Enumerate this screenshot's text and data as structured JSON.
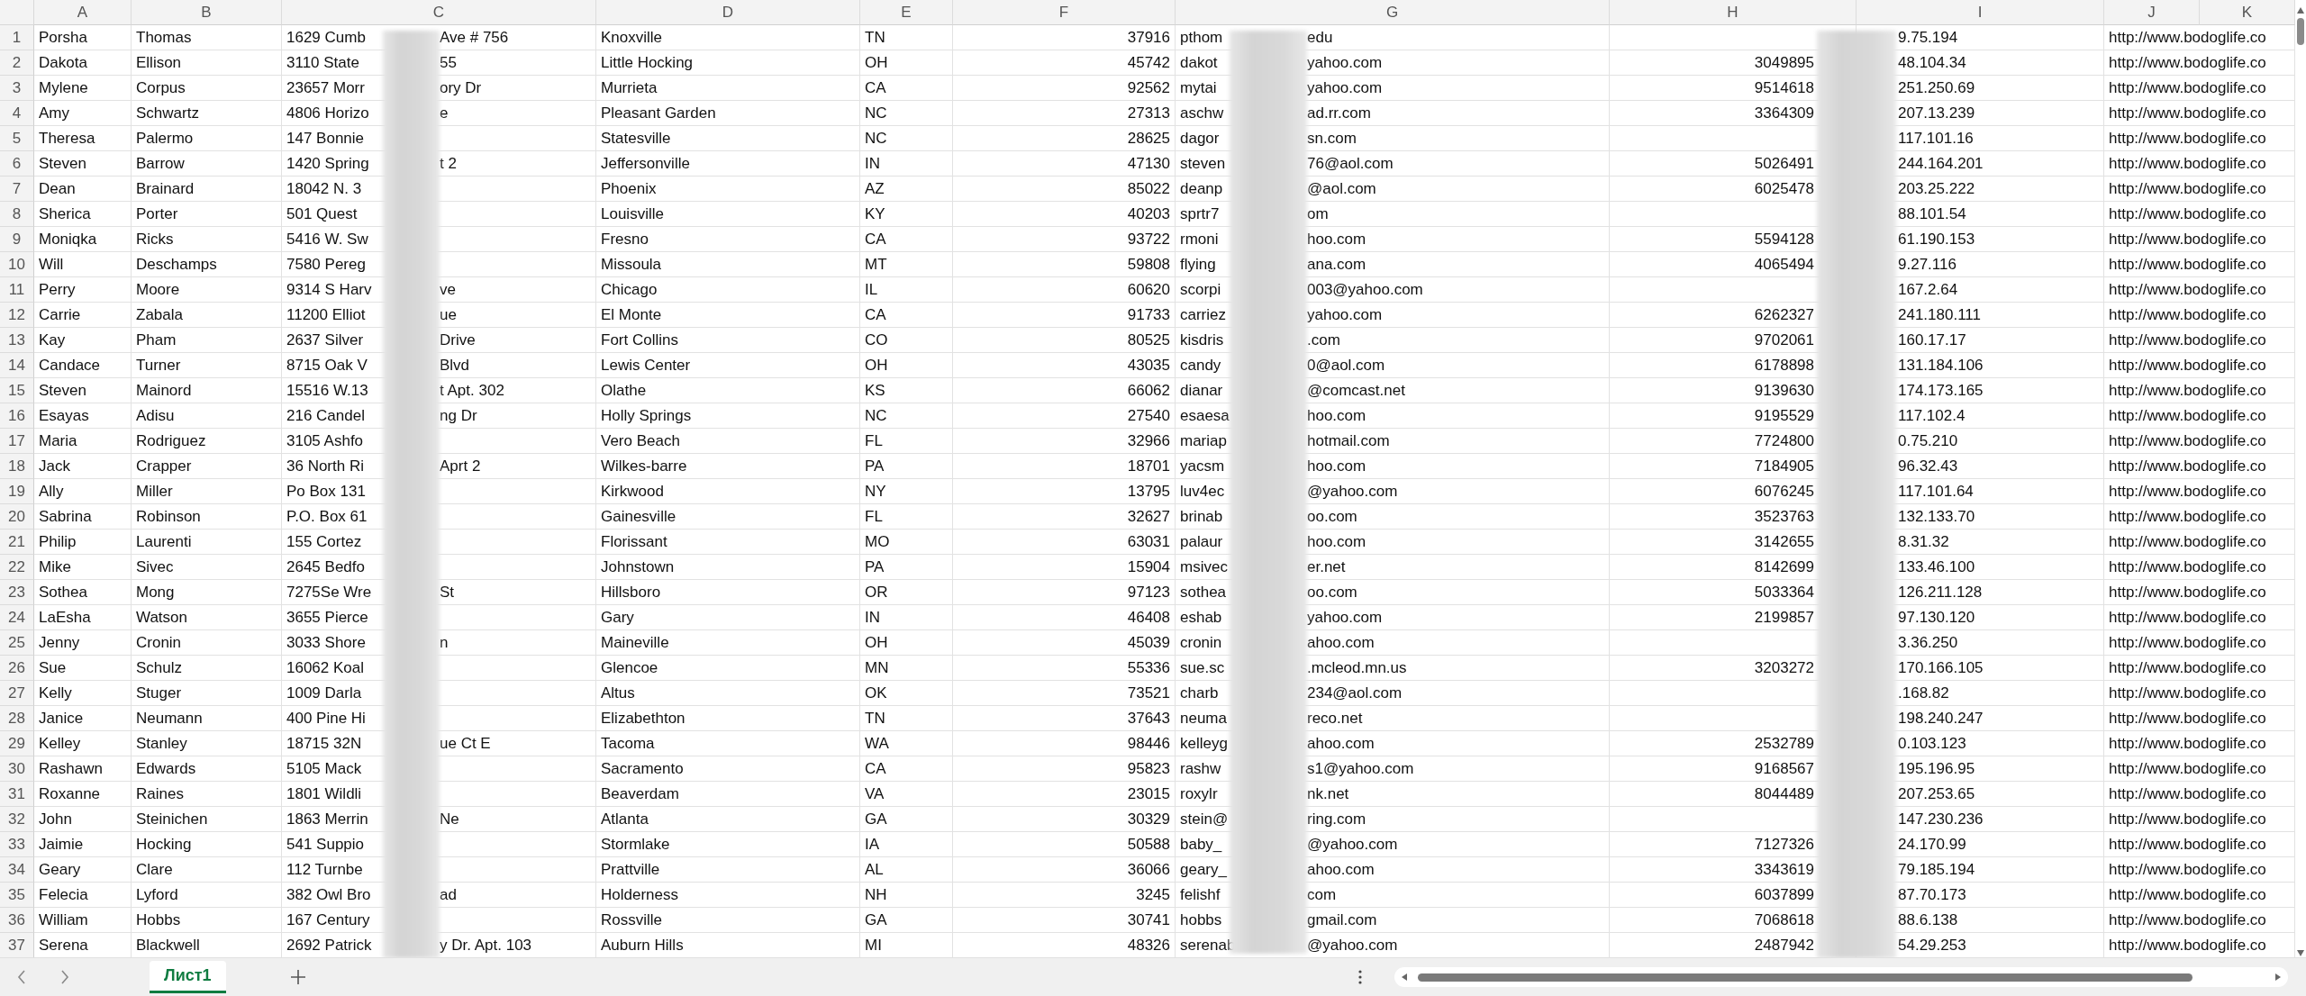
{
  "columns": [
    "A",
    "B",
    "C",
    "D",
    "E",
    "F",
    "G",
    "H",
    "I",
    "J",
    "K"
  ],
  "rows": [
    {
      "n": "1",
      "a": "Porsha",
      "b": "Thomas",
      "c": {
        "start": "1629 Cumb",
        "end": "Ave # 756"
      },
      "d": "Knoxville",
      "e": "TN",
      "f": "37916",
      "g": {
        "start": "pthom",
        "end": "edu"
      },
      "i": "9.75.194",
      "j": "http://www.bodoglife.co"
    },
    {
      "n": "2",
      "a": "Dakota",
      "b": "Ellison",
      "c": {
        "start": "3110 State",
        "end": "55"
      },
      "d": "Little Hocking",
      "e": "OH",
      "f": "45742",
      "g": {
        "start": "dakot",
        "end": "yahoo.com"
      },
      "h": "3049895",
      "i": "48.104.34",
      "j": "http://www.bodoglife.co"
    },
    {
      "n": "3",
      "a": "Mylene",
      "b": "Corpus",
      "c": {
        "start": "23657 Morr",
        "end": "ory Dr"
      },
      "d": "Murrieta",
      "e": "CA",
      "f": "92562",
      "g": {
        "start": "mytai",
        "end": "yahoo.com"
      },
      "h": "9514618",
      "i": "251.250.69",
      "j": "http://www.bodoglife.co"
    },
    {
      "n": "4",
      "a": "Amy",
      "b": "Schwartz",
      "c": {
        "start": "4806 Horizo",
        "end": "e"
      },
      "d": "Pleasant Garden",
      "e": "NC",
      "f": "27313",
      "g": {
        "start": "aschw",
        "end": "ad.rr.com"
      },
      "h": "3364309",
      "i": "207.13.239",
      "j": "http://www.bodoglife.co"
    },
    {
      "n": "5",
      "a": "Theresa",
      "b": "Palermo",
      "c": {
        "start": "147 Bonnie"
      },
      "d": "Statesville",
      "e": "NC",
      "f": "28625",
      "g": {
        "start": "dagor",
        "end": "sn.com"
      },
      "i": "117.101.16",
      "j": "http://www.bodoglife.co"
    },
    {
      "n": "6",
      "a": "Steven",
      "b": "Barrow",
      "c": {
        "start": "1420 Spring",
        "end": "t 2"
      },
      "d": "Jeffersonville",
      "e": "IN",
      "f": "47130",
      "g": {
        "start": "steven",
        "end": "76@aol.com"
      },
      "h": "5026491",
      "i": "244.164.201",
      "j": "http://www.bodoglife.co"
    },
    {
      "n": "7",
      "a": "Dean",
      "b": "Brainard",
      "c": {
        "start": "18042 N. 3"
      },
      "d": "Phoenix",
      "e": "AZ",
      "f": "85022",
      "g": {
        "start": "deanp",
        "end": "@aol.com"
      },
      "h": "6025478",
      "i": "203.25.222",
      "j": "http://www.bodoglife.co"
    },
    {
      "n": "8",
      "a": "Sherica",
      "b": "Porter",
      "c": {
        "start": "501 Quest"
      },
      "d": "Louisville",
      "e": "KY",
      "f": "40203",
      "g": {
        "start": "sprtr7",
        "end": "om"
      },
      "i": "88.101.54",
      "j": "http://www.bodoglife.co"
    },
    {
      "n": "9",
      "a": "Moniqka",
      "b": "Ricks",
      "c": {
        "start": "5416 W. Sw"
      },
      "d": "Fresno",
      "e": "CA",
      "f": "93722",
      "g": {
        "start": "rmoni",
        "end": "hoo.com"
      },
      "h": "5594128",
      "i": "61.190.153",
      "j": "http://www.bodoglife.co"
    },
    {
      "n": "10",
      "a": "Will",
      "b": "Deschamps",
      "c": {
        "start": "7580 Pereg"
      },
      "d": "Missoula",
      "e": "MT",
      "f": "59808",
      "g": {
        "start": "flying",
        "end": "ana.com"
      },
      "h": "4065494",
      "i": "9.27.116",
      "j": "http://www.bodoglife.co"
    },
    {
      "n": "11",
      "a": "Perry",
      "b": "Moore",
      "c": {
        "start": "9314 S Harv",
        "end": "ve"
      },
      "d": "Chicago",
      "e": "IL",
      "f": "60620",
      "g": {
        "start": "scorpi",
        "end": "003@yahoo.com"
      },
      "i": "167.2.64",
      "j": "http://www.bodoglife.co"
    },
    {
      "n": "12",
      "a": "Carrie",
      "b": "Zabala",
      "c": {
        "start": "11200 Elliot",
        "end": "ue"
      },
      "d": "El Monte",
      "e": "CA",
      "f": "91733",
      "g": {
        "start": "carriez",
        "end": "yahoo.com"
      },
      "h": "6262327",
      "i": "241.180.111",
      "j": "http://www.bodoglife.co"
    },
    {
      "n": "13",
      "a": "Kay",
      "b": "Pham",
      "c": {
        "start": "2637 Silver",
        "end": "Drive"
      },
      "d": "Fort Collins",
      "e": "CO",
      "f": "80525",
      "g": {
        "start": "kisdris",
        "end": ".com"
      },
      "h": "9702061",
      "i": "160.17.17",
      "j": "http://www.bodoglife.co"
    },
    {
      "n": "14",
      "a": "Candace",
      "b": "Turner",
      "c": {
        "start": "8715 Oak V",
        "end": "Blvd"
      },
      "d": "Lewis Center",
      "e": "OH",
      "f": "43035",
      "g": {
        "start": "candy",
        "end": "0@aol.com"
      },
      "h": "6178898",
      "i": "131.184.106",
      "j": "http://www.bodoglife.co"
    },
    {
      "n": "15",
      "a": "Steven",
      "b": "Mainord",
      "c": {
        "start": "15516 W.13",
        "end": "t Apt. 302"
      },
      "d": "Olathe",
      "e": "KS",
      "f": "66062",
      "g": {
        "start": "dianar",
        "end": "@comcast.net"
      },
      "h": "9139630",
      "i": "174.173.165",
      "j": "http://www.bodoglife.co"
    },
    {
      "n": "16",
      "a": "Esayas",
      "b": "Adisu",
      "c": {
        "start": "216 Candel",
        "end": "ng Dr"
      },
      "d": "Holly Springs",
      "e": "NC",
      "f": "27540",
      "g": {
        "start": "esaesa",
        "end": "hoo.com"
      },
      "h": "9195529",
      "i": "117.102.4",
      "j": "http://www.bodoglife.co"
    },
    {
      "n": "17",
      "a": "Maria",
      "b": "Rodriguez",
      "c": {
        "start": "3105 Ashfo"
      },
      "d": "Vero Beach",
      "e": "FL",
      "f": "32966",
      "g": {
        "start": "mariap",
        "end": "hotmail.com"
      },
      "h": "7724800",
      "i": "0.75.210",
      "j": "http://www.bodoglife.co"
    },
    {
      "n": "18",
      "a": "Jack",
      "b": "Crapper",
      "c": {
        "start": "36 North Ri",
        "end": "Aprt 2"
      },
      "d": "Wilkes-barre",
      "e": "PA",
      "f": "18701",
      "g": {
        "start": "yacsm",
        "end": "hoo.com"
      },
      "h": "7184905",
      "i": "96.32.43",
      "j": "http://www.bodoglife.co"
    },
    {
      "n": "19",
      "a": "Ally",
      "b": "Miller",
      "c": {
        "start": "Po Box 131"
      },
      "d": "Kirkwood",
      "e": "NY",
      "f": "13795",
      "g": {
        "start": "luv4ec",
        "end": "@yahoo.com"
      },
      "h": "6076245",
      "i": "117.101.64",
      "j": "http://www.bodoglife.co"
    },
    {
      "n": "20",
      "a": "Sabrina",
      "b": "Robinson",
      "c": {
        "start": "P.O. Box 61"
      },
      "d": "Gainesville",
      "e": "FL",
      "f": "32627",
      "g": {
        "start": "brinab",
        "end": "oo.com"
      },
      "h": "3523763",
      "i": "132.133.70",
      "j": "http://www.bodoglife.co"
    },
    {
      "n": "21",
      "a": "Philip",
      "b": "Laurenti",
      "c": {
        "start": "155 Cortez"
      },
      "d": "Florissant",
      "e": "MO",
      "f": "63031",
      "g": {
        "start": "palaur",
        "end": "hoo.com"
      },
      "h": "3142655",
      "i": "8.31.32",
      "j": "http://www.bodoglife.co"
    },
    {
      "n": "22",
      "a": "Mike",
      "b": "Sivec",
      "c": {
        "start": "2645 Bedfo"
      },
      "d": "Johnstown",
      "e": "PA",
      "f": "15904",
      "g": {
        "start": "msivec",
        "end": "er.net"
      },
      "h": "8142699",
      "i": "133.46.100",
      "j": "http://www.bodoglife.co"
    },
    {
      "n": "23",
      "a": "Sothea",
      "b": "Mong",
      "c": {
        "start": "7275Se Wre",
        "end": "St"
      },
      "d": "Hillsboro",
      "e": "OR",
      "f": "97123",
      "g": {
        "start": "sothea",
        "end": "oo.com"
      },
      "h": "5033364",
      "i": "126.211.128",
      "j": "http://www.bodoglife.co"
    },
    {
      "n": "24",
      "a": "LaEsha",
      "b": "Watson",
      "c": {
        "start": "3655 Pierce"
      },
      "d": "Gary",
      "e": "IN",
      "f": "46408",
      "g": {
        "start": "eshab",
        "end": "yahoo.com"
      },
      "h": "2199857",
      "i": "97.130.120",
      "j": "http://www.bodoglife.co"
    },
    {
      "n": "25",
      "a": "Jenny",
      "b": "Cronin",
      "c": {
        "start": "3033 Shore",
        "end": "n"
      },
      "d": "Maineville",
      "e": "OH",
      "f": "45039",
      "g": {
        "start": "cronin",
        "end": "ahoo.com"
      },
      "i": "3.36.250",
      "j": "http://www.bodoglife.co"
    },
    {
      "n": "26",
      "a": "Sue",
      "b": "Schulz",
      "c": {
        "start": "16062 Koal"
      },
      "d": "Glencoe",
      "e": "MN",
      "f": "55336",
      "g": {
        "start": "sue.sc",
        "end": ".mcleod.mn.us"
      },
      "h": "3203272",
      "i": "170.166.105",
      "j": "http://www.bodoglife.co"
    },
    {
      "n": "27",
      "a": "Kelly",
      "b": "Stuger",
      "c": {
        "start": "1009 Darla"
      },
      "d": "Altus",
      "e": "OK",
      "f": "73521",
      "g": {
        "start": "charb",
        "end": "234@aol.com"
      },
      "i": ".168.82",
      "j": "http://www.bodoglife.co"
    },
    {
      "n": "28",
      "a": "Janice",
      "b": "Neumann",
      "c": {
        "start": "400 Pine Hi"
      },
      "d": "Elizabethton",
      "e": "TN",
      "f": "37643",
      "g": {
        "start": "neuma",
        "end": "reco.net"
      },
      "i": "198.240.247",
      "j": "http://www.bodoglife.co"
    },
    {
      "n": "29",
      "a": "Kelley",
      "b": "Stanley",
      "c": {
        "start": "18715 32N",
        "end": "ue Ct E"
      },
      "d": "Tacoma",
      "e": "WA",
      "f": "98446",
      "g": {
        "start": "kelleyg",
        "end": "ahoo.com"
      },
      "h": "2532789",
      "i": "0.103.123",
      "j": "http://www.bodoglife.co"
    },
    {
      "n": "30",
      "a": "Rashawn",
      "b": "Edwards",
      "c": {
        "start": "5105 Mack"
      },
      "d": "Sacramento",
      "e": "CA",
      "f": "95823",
      "g": {
        "start": "rashw",
        "end": "s1@yahoo.com"
      },
      "h": "9168567",
      "i": "195.196.95",
      "j": "http://www.bodoglife.co"
    },
    {
      "n": "31",
      "a": "Roxanne",
      "b": "Raines",
      "c": {
        "start": "1801 Wildli"
      },
      "d": "Beaverdam",
      "e": "VA",
      "f": "23015",
      "g": {
        "start": "roxylr",
        "end": "nk.net"
      },
      "h": "8044489",
      "i": "207.253.65",
      "j": "http://www.bodoglife.co"
    },
    {
      "n": "32",
      "a": "John",
      "b": "Steinichen",
      "c": {
        "start": "1863 Merrin",
        "end": "Ne"
      },
      "d": "Atlanta",
      "e": "GA",
      "f": "30329",
      "g": {
        "start": "stein@",
        "end": "ring.com"
      },
      "i": "147.230.236",
      "j": "http://www.bodoglife.co"
    },
    {
      "n": "33",
      "a": "Jaimie",
      "b": "Hocking",
      "c": {
        "start": "541 Suppio"
      },
      "d": "Stormlake",
      "e": "IA",
      "f": "50588",
      "g": {
        "start": "baby_",
        "end": "@yahoo.com"
      },
      "h": "7127326",
      "i": "24.170.99",
      "j": "http://www.bodoglife.co"
    },
    {
      "n": "34",
      "a": "Geary",
      "b": "Clare",
      "c": {
        "start": "112 Turnbe"
      },
      "d": "Prattville",
      "e": "AL",
      "f": "36066",
      "g": {
        "start": "geary_",
        "end": "ahoo.com"
      },
      "h": "3343619",
      "i": "79.185.194",
      "j": "http://www.bodoglife.co"
    },
    {
      "n": "35",
      "a": "Felecia",
      "b": "Lyford",
      "c": {
        "start": "382 Owl Bro",
        "end": "ad"
      },
      "d": "Holderness",
      "e": "NH",
      "f": "3245",
      "g": {
        "start": "felishf",
        "end": "com"
      },
      "h": "6037899",
      "i": "87.70.173",
      "j": "http://www.bodoglife.co"
    },
    {
      "n": "36",
      "a": "William",
      "b": "Hobbs",
      "c": {
        "start": "167 Century"
      },
      "d": "Rossville",
      "e": "GA",
      "f": "30741",
      "g": {
        "start": "hobbs",
        "end": "gmail.com"
      },
      "h": "7068618",
      "i": "88.6.138",
      "j": "http://www.bodoglife.co"
    },
    {
      "n": "37",
      "a": "Serena",
      "b": "Blackwell",
      "c": {
        "start": "2692 Patrick",
        "end": "y Dr. Apt. 103"
      },
      "d": "Auburn Hills",
      "e": "MI",
      "f": "48326",
      "g": {
        "start": "serenab",
        "end": "@yahoo.com"
      },
      "h": "2487942",
      "i": "54.29.253",
      "j": "http://www.bodoglife.co"
    }
  ],
  "sheets": [
    {
      "label": "Лист1",
      "selected": true
    }
  ]
}
